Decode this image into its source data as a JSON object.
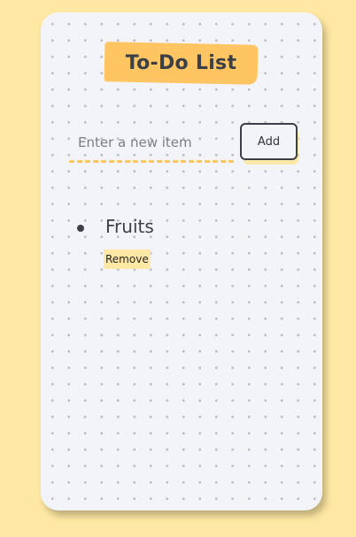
{
  "app": {
    "title": "To-Do List"
  },
  "form": {
    "input_value": "",
    "input_placeholder": "Enter a new item",
    "add_label": "Add"
  },
  "todos": [
    {
      "text": "Fruits",
      "remove_label": "Remove"
    }
  ],
  "colors": {
    "page_background": "#ffe8a3",
    "card_background": "#f2f4f7",
    "accent": "#ffc563",
    "text": "#3b3f47"
  }
}
